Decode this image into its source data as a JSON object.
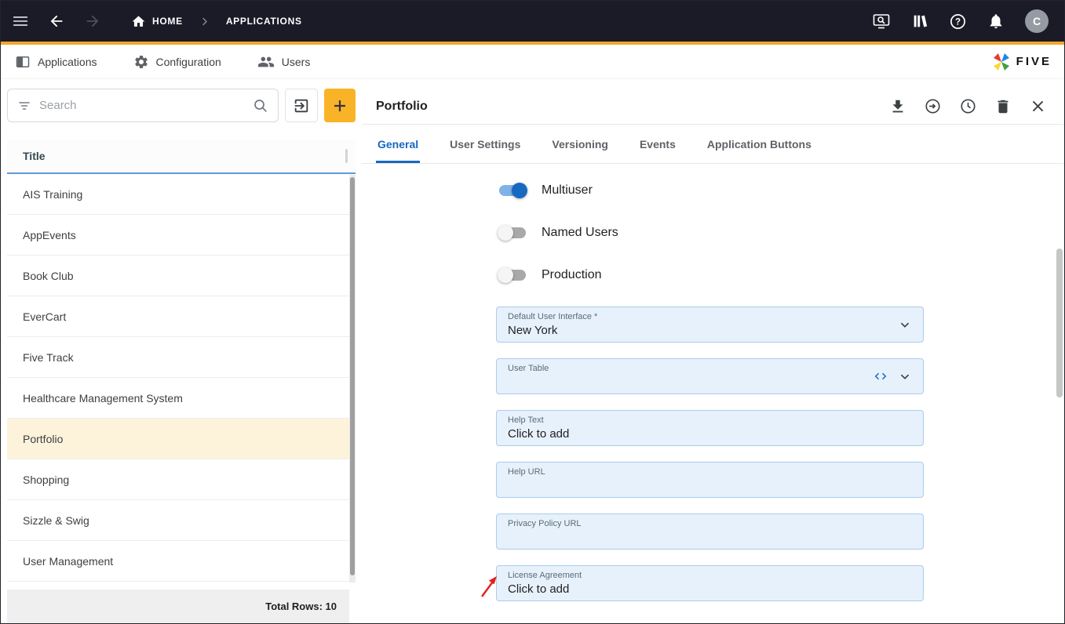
{
  "colors": {
    "topbar_bg": "#1b1b28",
    "accent_yellow": "#f2a52c",
    "accent_blue": "#1669c1",
    "field_bg": "#e7f1fb",
    "field_border": "#a9cdec",
    "selected_row_bg": "#fdf3da",
    "annotation_red": "#e02020"
  },
  "topbar": {
    "breadcrumb": {
      "home": "HOME",
      "current": "APPLICATIONS"
    },
    "avatar_initial": "C",
    "icons": [
      "menu-icon",
      "back-arrow-icon",
      "forward-arrow-icon",
      "home-icon",
      "screen-search-icon",
      "library-icon",
      "help-icon",
      "notifications-icon"
    ]
  },
  "nav": {
    "tabs": [
      {
        "label": "Applications",
        "icon": "applications-icon"
      },
      {
        "label": "Configuration",
        "icon": "configuration-gear-icon"
      },
      {
        "label": "Users",
        "icon": "users-icon"
      }
    ],
    "brand": "FIVE"
  },
  "list": {
    "search_placeholder": "Search",
    "column_header": "Title",
    "rows": [
      "AIS Training",
      "AppEvents",
      "Book Club",
      "EverCart",
      "Five Track",
      "Healthcare Management System",
      "Portfolio",
      "Shopping",
      "Sizzle & Swig",
      "User Management"
    ],
    "selected_row": "Portfolio",
    "footer": "Total Rows: 10"
  },
  "detail": {
    "title": "Portfolio",
    "header_icons": [
      "download-icon",
      "open-record-icon",
      "history-icon",
      "delete-icon",
      "close-icon"
    ],
    "tabs": [
      "General",
      "User Settings",
      "Versioning",
      "Events",
      "Application Buttons"
    ],
    "active_tab": "General",
    "toggles": [
      {
        "label": "Multiuser",
        "on": true
      },
      {
        "label": "Named Users",
        "on": false
      },
      {
        "label": "Production",
        "on": false
      }
    ],
    "fields": [
      {
        "label": "Default User Interface *",
        "value": "New York"
      },
      {
        "label": "User Table",
        "value": ""
      },
      {
        "label": "Help Text",
        "value": "Click to add"
      },
      {
        "label": "Help URL",
        "value": ""
      },
      {
        "label": "Privacy Policy URL",
        "value": ""
      },
      {
        "label": "License Agreement",
        "value": "Click to add"
      }
    ]
  }
}
